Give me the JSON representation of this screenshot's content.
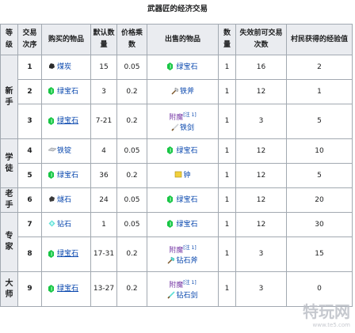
{
  "caption": "武器匠的经济交易",
  "headers": [
    "等级",
    "交易次序",
    "购买的物品",
    "默认数量",
    "价格乘数",
    "出售的物品",
    "数量",
    "失效前可交易次数",
    "村民获得的经验值"
  ],
  "levels": [
    "新手",
    "学徒",
    "老手",
    "专家",
    "大师"
  ],
  "rows": [
    {
      "order": "1",
      "buy": "煤炭",
      "buy_icon": "coal-icon",
      "qty": "15",
      "mult": "0.05",
      "sell": "绿宝石",
      "sell_icon": "emerald-icon",
      "sqty": "1",
      "uses": "16",
      "xp": "2"
    },
    {
      "order": "2",
      "buy": "绿宝石",
      "buy_icon": "emerald-icon",
      "qty": "3",
      "mult": "0.2",
      "sell": "铁斧",
      "sell_icon": "iron-axe-icon",
      "sqty": "1",
      "uses": "12",
      "xp": "1"
    },
    {
      "order": "3",
      "buy": "绿宝石",
      "buy_icon": "emerald-icon",
      "qty": "7-21",
      "mult": "0.2",
      "ench": "附魔",
      "note": "[注 1]",
      "sell": "铁剑",
      "sell_icon": "iron-sword-icon",
      "sqty": "1",
      "uses": "3",
      "xp": "5"
    },
    {
      "order": "4",
      "buy": "铁锭",
      "buy_icon": "iron-ingot-icon",
      "qty": "4",
      "mult": "0.05",
      "sell": "绿宝石",
      "sell_icon": "emerald-icon",
      "sqty": "1",
      "uses": "12",
      "xp": "10"
    },
    {
      "order": "5",
      "buy": "绿宝石",
      "buy_icon": "emerald-icon",
      "qty": "36",
      "mult": "0.2",
      "sell": "钟",
      "sell_icon": "bell-icon",
      "sqty": "1",
      "uses": "12",
      "xp": "5"
    },
    {
      "order": "6",
      "buy": "燧石",
      "buy_icon": "flint-icon",
      "qty": "24",
      "mult": "0.05",
      "sell": "绿宝石",
      "sell_icon": "emerald-icon",
      "sqty": "1",
      "uses": "12",
      "xp": "20"
    },
    {
      "order": "7",
      "buy": "钻石",
      "buy_icon": "diamond-icon",
      "qty": "1",
      "mult": "0.05",
      "sell": "绿宝石",
      "sell_icon": "emerald-icon",
      "sqty": "1",
      "uses": "12",
      "xp": "30"
    },
    {
      "order": "8",
      "buy": "绿宝石",
      "buy_icon": "emerald-icon",
      "qty": "17-31",
      "mult": "0.2",
      "ench": "附魔",
      "note": "[注 1]",
      "sell": "钻石斧",
      "sell_icon": "diamond-axe-icon",
      "sqty": "1",
      "uses": "3",
      "xp": "15"
    },
    {
      "order": "9",
      "buy": "绿宝石",
      "buy_icon": "emerald-icon",
      "qty": "13-27",
      "mult": "0.2",
      "ench": "附魔",
      "note": "[注 1]",
      "sell": "钻石剑",
      "sell_icon": "diamond-sword-icon",
      "sqty": "1",
      "uses": "3",
      "xp": "0"
    }
  ],
  "watermark": {
    "brand": "特玩网",
    "url": "www.te5.com"
  }
}
